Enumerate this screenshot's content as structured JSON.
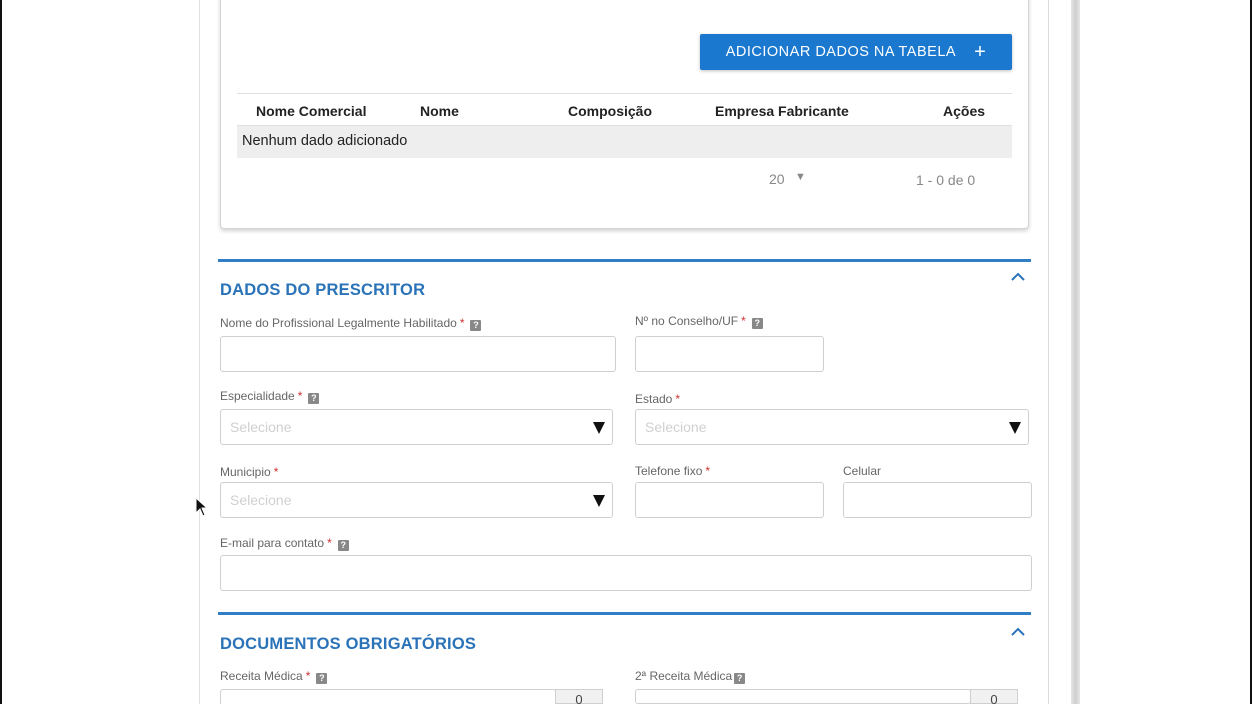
{
  "top_card": {
    "add_button_label": "ADICIONAR DADOS NA TABELA",
    "add_button_icon": "plus-icon",
    "table": {
      "columns": [
        "Nome Comercial",
        "Nome",
        "Composição",
        "Empresa Fabricante",
        "Ações"
      ],
      "empty_message": "Nenhum dado adicionado"
    },
    "pagination": {
      "page_size": "20",
      "range": "1 - 0 de 0"
    }
  },
  "prescritor": {
    "title": "DADOS DO PRESCRITOR",
    "nome_label": "Nome do Profissional Legalmente Habilitado",
    "conselho_label": "Nº no Conselho/UF",
    "especialidade_label": "Especialidade",
    "especialidade_placeholder": "Selecione",
    "estado_label": "Estado",
    "estado_placeholder": "Selecione",
    "municipio_label": "Municipio",
    "municipio_placeholder": "Selecione",
    "telefone_label": "Telefone fixo",
    "celular_label": "Celular",
    "email_label": "E-mail para contato",
    "required_mark": "*",
    "help_mark": "?"
  },
  "documentos": {
    "title": "DOCUMENTOS OBRIGATÓRIOS",
    "receita_label": "Receita Médica",
    "receita2_label": "2ª Receita Médica",
    "file_button_glyph": "0"
  },
  "colors": {
    "accent": "#2a73b8",
    "button": "#1a78cf",
    "required": "#d32f2f"
  }
}
